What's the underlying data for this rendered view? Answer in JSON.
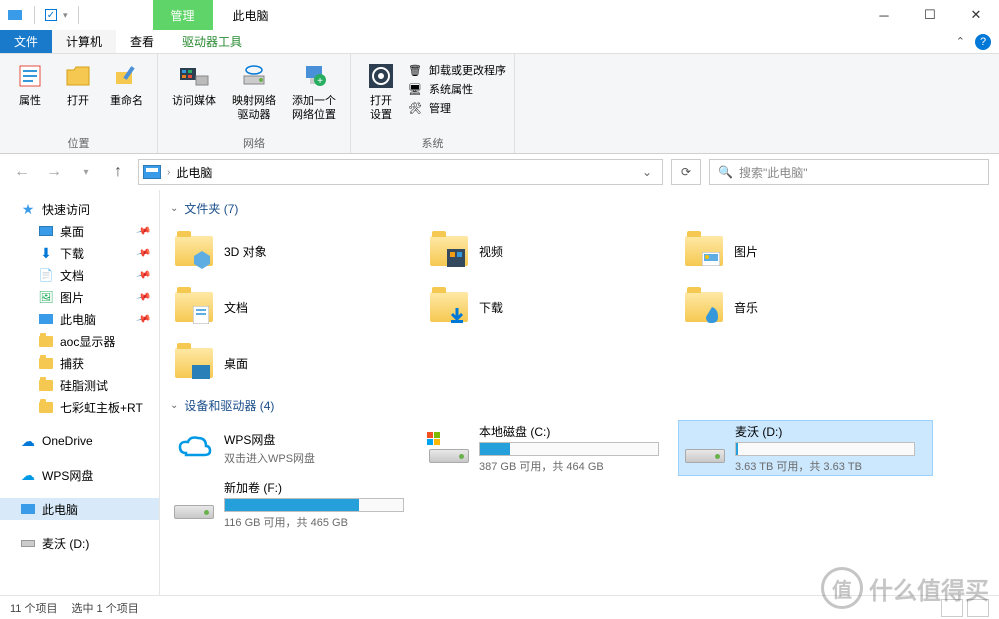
{
  "title": "此电脑",
  "context_tab": "管理",
  "tabs": {
    "file": "文件",
    "computer": "计算机",
    "view": "查看",
    "tools": "驱动器工具"
  },
  "ribbon": {
    "g1": {
      "label": "位置",
      "b1": "属性",
      "b2": "打开",
      "b3": "重命名"
    },
    "g2": {
      "label": "网络",
      "b1": "访问媒体",
      "b2": "映射网络\n驱动器",
      "b3": "添加一个\n网络位置"
    },
    "g3": {
      "label": "系统",
      "b1": "打开\n设置",
      "l1": "卸载或更改程序",
      "l2": "系统属性",
      "l3": "管理"
    }
  },
  "address": {
    "path": "此电脑",
    "search_placeholder": "搜索\"此电脑\""
  },
  "nav": {
    "quick": "快速访问",
    "items": [
      {
        "label": "桌面",
        "pin": true,
        "icon": "desktop"
      },
      {
        "label": "下载",
        "pin": true,
        "icon": "download"
      },
      {
        "label": "文档",
        "pin": true,
        "icon": "doc"
      },
      {
        "label": "图片",
        "pin": true,
        "icon": "pic"
      },
      {
        "label": "此电脑",
        "pin": true,
        "icon": "pc"
      },
      {
        "label": "aoc显示器",
        "pin": false,
        "icon": "folder"
      },
      {
        "label": "捕获",
        "pin": false,
        "icon": "folder"
      },
      {
        "label": "硅脂测试",
        "pin": false,
        "icon": "folder"
      },
      {
        "label": "七彩虹主板+RT",
        "pin": false,
        "icon": "folder"
      }
    ],
    "onedrive": "OneDrive",
    "wps": "WPS网盘",
    "thispc": "此电脑",
    "drive": "麦沃 (D:)"
  },
  "sections": {
    "folders": {
      "title": "文件夹 (7)",
      "items": [
        "3D 对象",
        "视频",
        "图片",
        "文档",
        "下载",
        "音乐",
        "桌面"
      ]
    },
    "devices": {
      "title": "设备和驱动器 (4)",
      "items": [
        {
          "name": "WPS网盘",
          "sub": "双击进入WPS网盘",
          "type": "cloud"
        },
        {
          "name": "本地磁盘 (C:)",
          "sub": "387 GB 可用，共 464 GB",
          "type": "drive",
          "fill": 17
        },
        {
          "name": "麦沃 (D:)",
          "sub": "3.63 TB 可用，共 3.63 TB",
          "type": "drive",
          "fill": 1,
          "selected": true
        },
        {
          "name": "新加卷 (F:)",
          "sub": "116 GB 可用，共 465 GB",
          "type": "drive",
          "fill": 75
        }
      ]
    }
  },
  "status": {
    "count": "11 个项目",
    "selected": "选中 1 个项目"
  },
  "watermark": "什么值得买"
}
